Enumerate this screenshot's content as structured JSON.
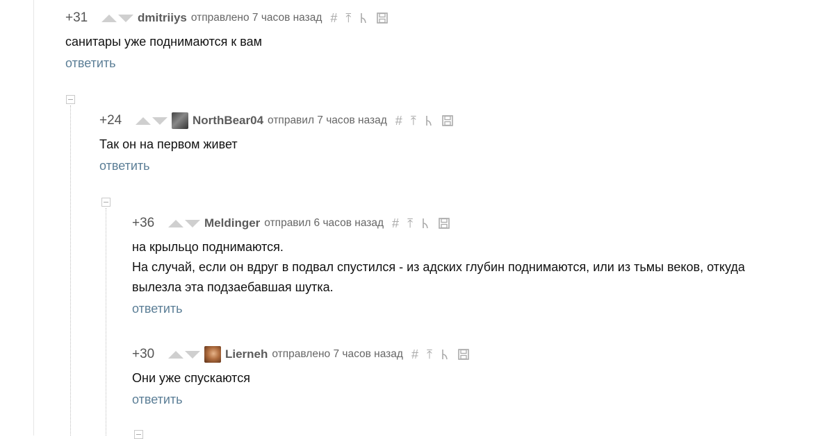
{
  "comments": [
    {
      "rating": "+31",
      "author": "dmitriiys",
      "posted": "отправлено 7 часов назад",
      "text": [
        "санитары уже поднимаются к вам"
      ],
      "reply": "ответить"
    },
    {
      "rating": "+24",
      "author": "NorthBear04",
      "posted": "отправил 7 часов назад",
      "text": [
        "Так он на первом живет"
      ],
      "reply": "ответить"
    },
    {
      "rating": "+36",
      "author": "Meldinger",
      "posted": "отправил 6 часов назад",
      "text": [
        "на крыльцо поднимаются.",
        "На случай, если он вдруг в подвал спустился - из адских глубин поднимаются, или из тьмы веков, откуда",
        "вылезла эта подзаебавшая шутка."
      ],
      "reply": "ответить"
    },
    {
      "rating": "+30",
      "author": "Lierneh",
      "posted": "отправлено 7 часов назад",
      "text": [
        "Они уже спускаются"
      ],
      "reply": "ответить"
    }
  ],
  "icons": {
    "permalink": "#",
    "parent": "⤒",
    "branch": "branch-icon",
    "save": "save-icon"
  }
}
